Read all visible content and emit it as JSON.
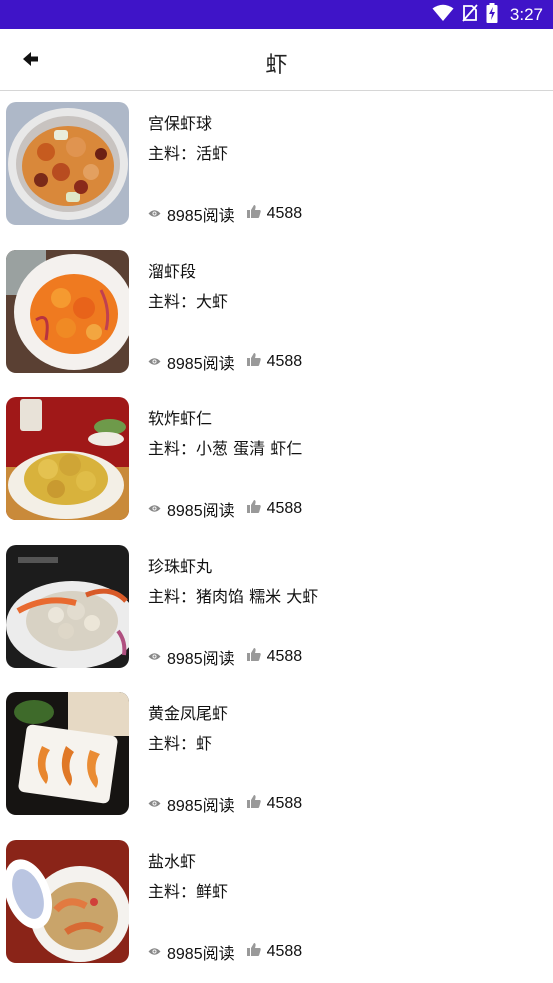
{
  "status_bar": {
    "time": "3:27",
    "icons": [
      "wifi-icon",
      "no-sim-icon",
      "battery-charging-icon"
    ],
    "background": "#3f14c8"
  },
  "header": {
    "title": "虾",
    "back_icon": "back-arrow-icon"
  },
  "ingredient_prefix": "主料：",
  "recipes": [
    {
      "name": "宫保虾球",
      "ingredients": "活虾",
      "reads": "8985阅读",
      "likes": "4588"
    },
    {
      "name": "溜虾段",
      "ingredients": "大虾",
      "reads": "8985阅读",
      "likes": "4588"
    },
    {
      "name": "软炸虾仁",
      "ingredients": "小葱 蛋清 虾仁",
      "reads": "8985阅读",
      "likes": "4588"
    },
    {
      "name": "珍珠虾丸",
      "ingredients": "猪肉馅 糯米 大虾",
      "reads": "8985阅读",
      "likes": "4588"
    },
    {
      "name": "黄金凤尾虾",
      "ingredients": "虾",
      "reads": "8985阅读",
      "likes": "4588"
    },
    {
      "name": "盐水虾",
      "ingredients": "鲜虾",
      "reads": "8985阅读",
      "likes": "4588"
    }
  ]
}
